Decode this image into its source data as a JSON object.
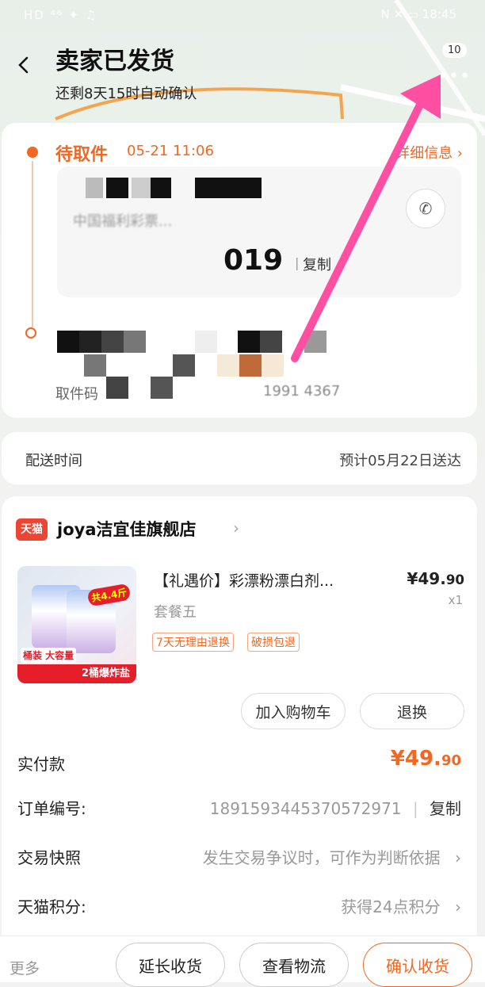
{
  "status_bar": {
    "left": "HD ⁴⁶ ✦ ♫",
    "right": "N ✕ ▭ 18:45"
  },
  "header": {
    "title": "卖家已发货",
    "subtitle": "还剩8天15时自动确认",
    "badge": "10"
  },
  "logistics": {
    "status": "待取件",
    "time": "05-21 11:06",
    "detail_link": "详细信息 ›",
    "station_name": "中国福利彩票...",
    "pickup_code_suffix": "019",
    "copy_label": "复制",
    "pickup_code_label": "取件码",
    "pickup_phone_tail": "1991 4367"
  },
  "delivery": {
    "label": "配送时间",
    "value": "预计05月22日送达"
  },
  "order": {
    "platform_logo": "天猫",
    "shop_name": "joya洁宜佳旗舰店",
    "product": {
      "title": "【礼遇价】彩漂粉漂白剂...",
      "sku": "套餐五",
      "tags": [
        "7天无理由退换",
        "破损包退"
      ],
      "price": "¥49.90",
      "price_main": "¥49.",
      "price_decimal": "90",
      "qty": "x1",
      "img_tag_bottom": "2桶爆炸盐",
      "img_tag_left": "桶装 大容量",
      "img_burst": "共4.4斤"
    },
    "buttons": {
      "add_cart": "加入购物车",
      "refund": "退换"
    },
    "paid": {
      "label": "实付款",
      "amount_main": "¥49.",
      "amount_decimal": "90"
    },
    "order_no": {
      "label": "订单编号:",
      "value": "1891593445370572971",
      "copy": "复制"
    },
    "snapshot": {
      "label": "交易快照",
      "value": "发生交易争议时，可作为判断依据"
    },
    "points": {
      "label": "天猫积分:",
      "value": "获得24点积分"
    }
  },
  "bottom_bar": {
    "more": "更多",
    "extend": "延长收货",
    "track": "查看物流",
    "confirm": "确认收货"
  },
  "colors": {
    "accent": "#f26722",
    "annotation_arrow": "#ff4fa3"
  }
}
